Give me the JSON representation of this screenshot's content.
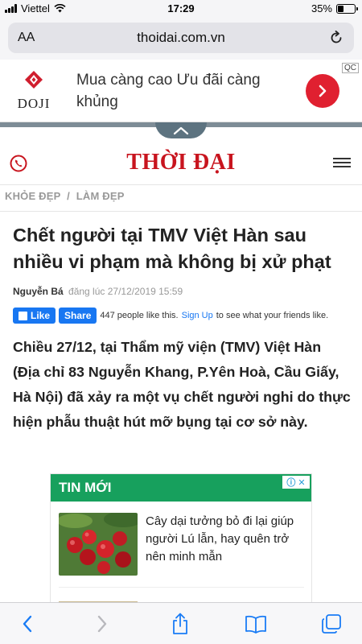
{
  "status": {
    "carrier": "Viettel",
    "time": "17:29",
    "battery_text": "35%",
    "battery_level": 0.35
  },
  "browser": {
    "aa_label": "AA",
    "url": "thoidai.com.vn"
  },
  "ad": {
    "brand": "DOJI",
    "text": "Mua càng cao Ưu đãi càng khủng",
    "badge": "QC"
  },
  "site": {
    "logo": "THỜI ĐẠI",
    "breadcrumb": [
      "KHỎE ĐẸP",
      "LÀM ĐẸP"
    ]
  },
  "article": {
    "headline": "Chết người tại TMV Việt Hàn sau nhiều vi phạm mà không bị xử phạt",
    "author": "Nguyễn Bá",
    "posted": "đăng lúc 27/12/2019 15:59",
    "lead": "Chiều 27/12, tại Thẩm mỹ viện (TMV) Việt Hàn (Địa chỉ 83 Nguyễn Khang, P.Yên Hoà, Cầu Giấy, Hà Nội) đã xảy ra một vụ chết người nghi do thực hiện phẫu thuật hút mỡ bụng tại cơ sở này."
  },
  "facebook": {
    "like_label": "Like",
    "share_label": "Share",
    "count_text": "447 people like this.",
    "signup_label": "Sign Up",
    "signup_suffix": "to see what your friends like."
  },
  "news_box": {
    "title": "TIN MỚI",
    "adchoice": "ⓘ ✕",
    "items": [
      {
        "title": "Cây dại tưởng bỏ đi lại giúp người Lú lẫn, hay quên trở nên minh mẫn"
      }
    ]
  },
  "colors": {
    "logo_red": "#c8141e",
    "news_green": "#17a05d",
    "ios_blue": "#1a7cf5",
    "facebook_blue": "#1877f2"
  },
  "icons": [
    "wifi-icon",
    "reload-icon",
    "phone-icon",
    "menu-icon",
    "back-icon",
    "forward-icon",
    "share-icon",
    "bookmarks-icon",
    "tabs-icon"
  ]
}
